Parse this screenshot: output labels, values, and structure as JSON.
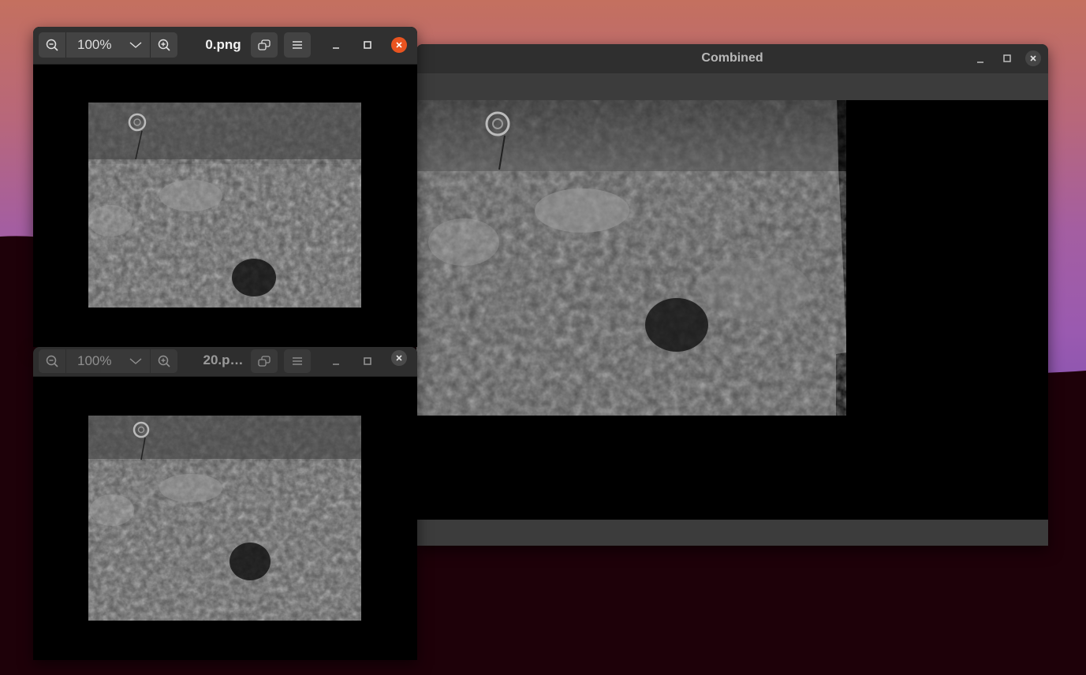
{
  "windows": {
    "combined": {
      "title": "Combined"
    },
    "viewer_top": {
      "zoom": "100%",
      "title": "0.png"
    },
    "viewer_bottom": {
      "zoom": "100%",
      "title": "20.p…"
    }
  },
  "colors": {
    "titlebar": "#303030",
    "toolbar_button": "#434343",
    "close_active": "#e95420",
    "desktop_hill": "#1e0109"
  },
  "icons": [
    "zoom-out-icon",
    "chevron-down-icon",
    "zoom-in-icon",
    "rotate-icon",
    "menu-icon",
    "minimize-icon",
    "maximize-icon",
    "close-icon"
  ]
}
